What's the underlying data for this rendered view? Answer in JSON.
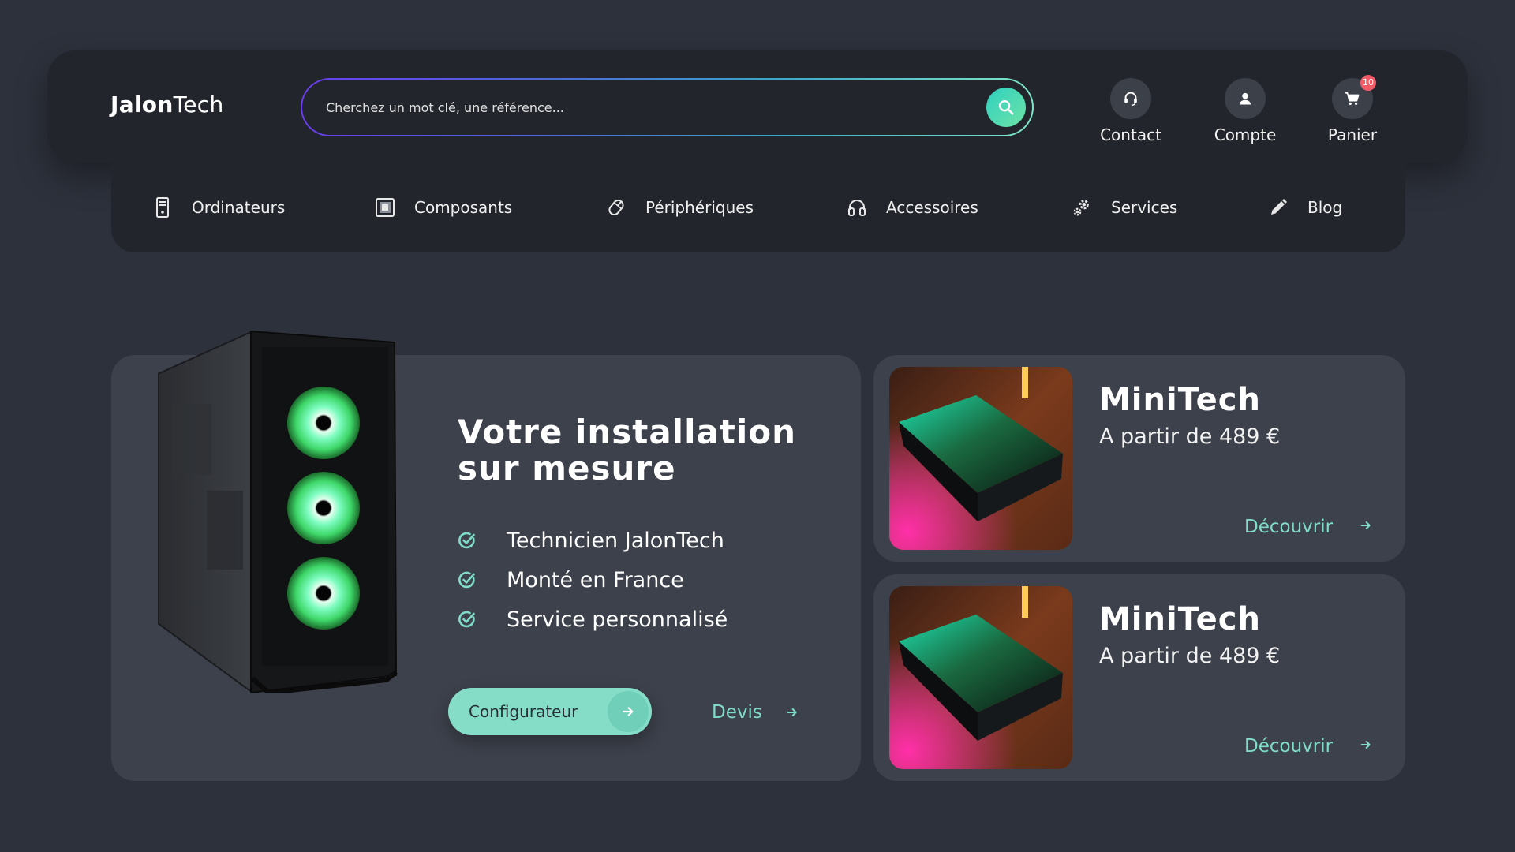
{
  "header": {
    "logo_bold": "Jalon",
    "logo_light": "Tech",
    "search": {
      "placeholder": "Cherchez un mot clé, une référence..."
    },
    "actions": [
      {
        "label": "Contact",
        "icon": "headset-icon"
      },
      {
        "label": "Compte",
        "icon": "user-icon"
      },
      {
        "label": "Panier",
        "icon": "cart-icon",
        "badge": "10"
      }
    ]
  },
  "nav": {
    "items": [
      {
        "label": "Ordinateurs",
        "icon": "computer-tower-icon"
      },
      {
        "label": "Composants",
        "icon": "chip-icon"
      },
      {
        "label": "Périphériques",
        "icon": "mouse-icon"
      },
      {
        "label": "Accessoires",
        "icon": "headphones-icon"
      },
      {
        "label": "Services",
        "icon": "gears-icon"
      },
      {
        "label": "Blog",
        "icon": "pencil-icon"
      }
    ]
  },
  "hero": {
    "title_line1": "Votre installation",
    "title_line2": "sur mesure",
    "bullets": [
      "Technicien JalonTech",
      "Monté en France",
      "Service personnalisé"
    ],
    "primary_button": "Configurateur",
    "secondary_link": "Devis"
  },
  "products": [
    {
      "name": "MiniTech",
      "price": "A partir de 489 €",
      "link": "Découvrir"
    },
    {
      "name": "MiniTech",
      "price": "A partir de 489 €",
      "link": "Découvrir"
    }
  ],
  "colors": {
    "background": "#2d313b",
    "panel": "#22252b",
    "card": "#3d414b",
    "accent": "#85ddc8",
    "badge": "#f25c69"
  }
}
